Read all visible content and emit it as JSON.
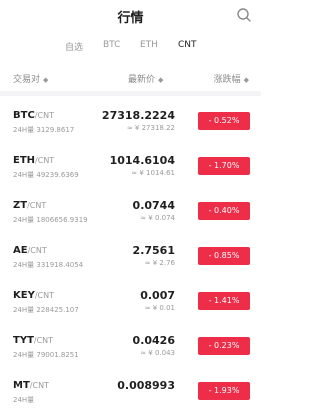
{
  "header": {
    "title": "行情",
    "search_icon": "search-icon"
  },
  "tabs": [
    {
      "label": "自选",
      "active": false
    },
    {
      "label": "BTC",
      "active": false
    },
    {
      "label": "ETH",
      "active": false
    },
    {
      "label": "CNT",
      "active": true
    }
  ],
  "columns": {
    "pair": "交易对",
    "price": "最新价",
    "change": "涨跌幅",
    "sort_icon": "sort-icon"
  },
  "colors": {
    "down": "#ee2d49"
  },
  "rows": [
    {
      "coin": "BTC",
      "quote": "/CNT",
      "volume": "24H量 3129.8617",
      "price": "27318.2224",
      "cny": "≈ ¥ 27318.22",
      "change": "- 0.52%"
    },
    {
      "coin": "ETH",
      "quote": "/CNT",
      "volume": "24H量 49239.6369",
      "price": "1014.6104",
      "cny": "≈ ¥ 1014.61",
      "change": "- 1.70%"
    },
    {
      "coin": "ZT",
      "quote": "/CNT",
      "volume": "24H量 1806656.9319",
      "price": "0.0744",
      "cny": "≈ ¥ 0.074",
      "change": "- 0.40%"
    },
    {
      "coin": "AE",
      "quote": "/CNT",
      "volume": "24H量 331918.4054",
      "price": "2.7561",
      "cny": "≈ ¥ 2.76",
      "change": "- 0.85%"
    },
    {
      "coin": "KEY",
      "quote": "/CNT",
      "volume": "24H量 228425.107",
      "price": "0.007",
      "cny": "≈ ¥ 0.01",
      "change": "- 1.41%"
    },
    {
      "coin": "TYT",
      "quote": "/CNT",
      "volume": "24H量 79001.8251",
      "price": "0.0426",
      "cny": "≈ ¥ 0.043",
      "change": "- 0.23%"
    },
    {
      "coin": "MT",
      "quote": "/CNT",
      "volume": "24H量",
      "price": "0.008993",
      "cny": "",
      "change": "- 1.93%"
    }
  ]
}
